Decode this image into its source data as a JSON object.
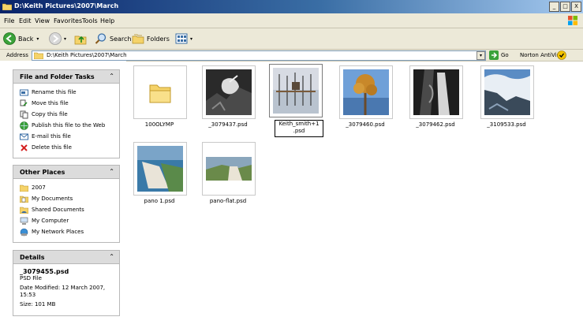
{
  "window": {
    "title": "D:\\Keith Pictures\\2007\\March",
    "min_label": "_",
    "max_label": "□",
    "close_label": "X"
  },
  "menu": [
    "File",
    "Edit",
    "View",
    "Favorites",
    "Tools",
    "Help"
  ],
  "toolbar": {
    "back_label": "Back",
    "search_label": "Search",
    "folders_label": "Folders"
  },
  "address": {
    "label": "Address",
    "value": "D:\\Keith Pictures\\2007\\March",
    "go_label": "Go",
    "norton_label": "Norton AntiVirus"
  },
  "tasks": {
    "title": "File and Folder Tasks",
    "items": [
      "Rename this file",
      "Move this file",
      "Copy this file",
      "Publish this file to the Web",
      "E-mail this file",
      "Delete this file"
    ]
  },
  "other_places": {
    "title": "Other Places",
    "items": [
      "2007",
      "My Documents",
      "Shared Documents",
      "My Computer",
      "My Network Places"
    ]
  },
  "details": {
    "title": "Details",
    "filename": "_3079455.psd",
    "filetype": "PSD File",
    "modified_line1": "Date Modified: 12 March 2007,",
    "modified_line2": "15:53",
    "size": "Size: 101 MB"
  },
  "files": [
    {
      "name": "100OLYMP"
    },
    {
      "name": "_3079437.psd"
    },
    {
      "name": "Keith_smith+1",
      "name2": ".psd"
    },
    {
      "name": "_3079460.psd"
    },
    {
      "name": "_3079462.psd"
    },
    {
      "name": "_3109533.psd"
    },
    {
      "name": "pano 1.psd"
    },
    {
      "name": "pano-flat.psd"
    }
  ],
  "colors": {
    "title_bar": "#0a246a",
    "panel_header": "#dcdcdc",
    "folder_yellow": "#f5d36a"
  }
}
